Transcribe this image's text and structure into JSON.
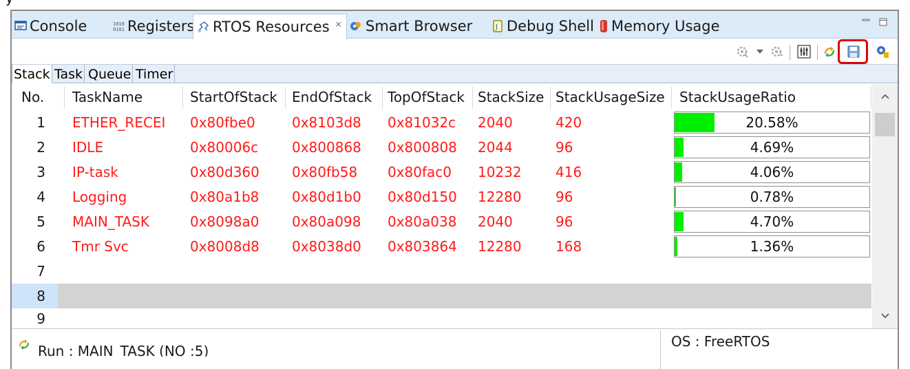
{
  "caption_partial": "y          ",
  "tabs": [
    {
      "label": "Console",
      "icon": "console-icon"
    },
    {
      "label": "Registers",
      "icon": "registers-icon"
    },
    {
      "label": "RTOS Resources",
      "icon": "rtos-resources-icon",
      "active": true
    },
    {
      "label": "Smart Browser",
      "icon": "smart-browser-icon"
    },
    {
      "label": "Debug Shell",
      "icon": "debug-shell-icon"
    },
    {
      "label": "Memory Usage",
      "icon": "memory-usage-icon"
    }
  ],
  "close_glyph": "⨯",
  "subtabs": [
    "Stack",
    "Task",
    "Queue",
    "Timer"
  ],
  "columns": [
    "No.",
    "TaskName",
    "StartOfStack",
    "EndOfStack",
    "TopOfStack",
    "StackSize",
    "StackUsageSize",
    "StackUsageRatio"
  ],
  "rows": [
    {
      "no": "1",
      "task": "ETHER_RECEI",
      "start": "0x80fbe0",
      "end": "0x8103d8",
      "top": "0x81032c",
      "size": "2040",
      "usage": "420",
      "ratio_text": "20.58%",
      "ratio": 20.58
    },
    {
      "no": "2",
      "task": "IDLE",
      "start": "0x80006c",
      "end": "0x800868",
      "top": "0x800808",
      "size": "2044",
      "usage": "96",
      "ratio_text": "4.69%",
      "ratio": 4.69
    },
    {
      "no": "3",
      "task": "IP-task",
      "start": "0x80d360",
      "end": "0x80fb58",
      "top": "0x80fac0",
      "size": "10232",
      "usage": "416",
      "ratio_text": "4.06%",
      "ratio": 4.06
    },
    {
      "no": "4",
      "task": "Logging",
      "start": "0x80a1b8",
      "end": "0x80d1b0",
      "top": "0x80d150",
      "size": "12280",
      "usage": "96",
      "ratio_text": "0.78%",
      "ratio": 0.78
    },
    {
      "no": "5",
      "task": "MAIN_TASK",
      "start": "0x8098a0",
      "end": "0x80a098",
      "top": "0x80a038",
      "size": "2040",
      "usage": "96",
      "ratio_text": "4.70%",
      "ratio": 4.7
    },
    {
      "no": "6",
      "task": "Tmr Svc",
      "start": "0x8008d8",
      "end": "0x8038d0",
      "top": "0x803864",
      "size": "12280",
      "usage": "168",
      "ratio_text": "1.36%",
      "ratio": 1.36
    },
    {
      "no": "7"
    },
    {
      "no": "8",
      "selected": true
    },
    {
      "no": "9"
    }
  ],
  "status": {
    "run": "Run : MAIN_TASK (NO :5)",
    "os": "OS : FreeRTOS"
  },
  "colors": {
    "task_text": "#ff1a1a",
    "ratio_fill": "#00ee00",
    "tabbar_bg": "#dcebf8",
    "highlight": "#e00000"
  }
}
